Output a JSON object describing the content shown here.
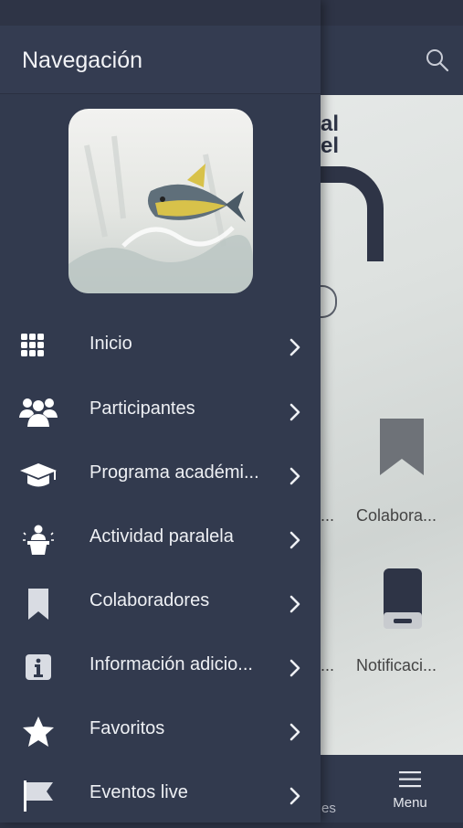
{
  "drawer": {
    "title": "Navegación",
    "items": [
      {
        "label": "Inicio",
        "icon": "grid-icon"
      },
      {
        "label": "Participantes",
        "icon": "people-icon"
      },
      {
        "label": "Programa académi...",
        "icon": "graduation-cap-icon"
      },
      {
        "label": "Actividad paralela",
        "icon": "speaker-podium-icon"
      },
      {
        "label": "Colaboradores",
        "icon": "bookmark-icon"
      },
      {
        "label": "Información adicio...",
        "icon": "info-icon"
      },
      {
        "label": "Favoritos",
        "icon": "star-icon"
      },
      {
        "label": "Eventos live",
        "icon": "flag-icon"
      }
    ]
  },
  "background": {
    "tiles": [
      {
        "label": "Colabora..."
      },
      {
        "label": "Notificaci..."
      }
    ],
    "truncated_labels": [
      "...",
      "..."
    ],
    "bottom_bar": {
      "menu_label": "Menu",
      "partial_label": "es"
    }
  },
  "colors": {
    "drawer_bg": "#323a4e",
    "header_bg": "#343c51",
    "text": "#eef0f4"
  }
}
